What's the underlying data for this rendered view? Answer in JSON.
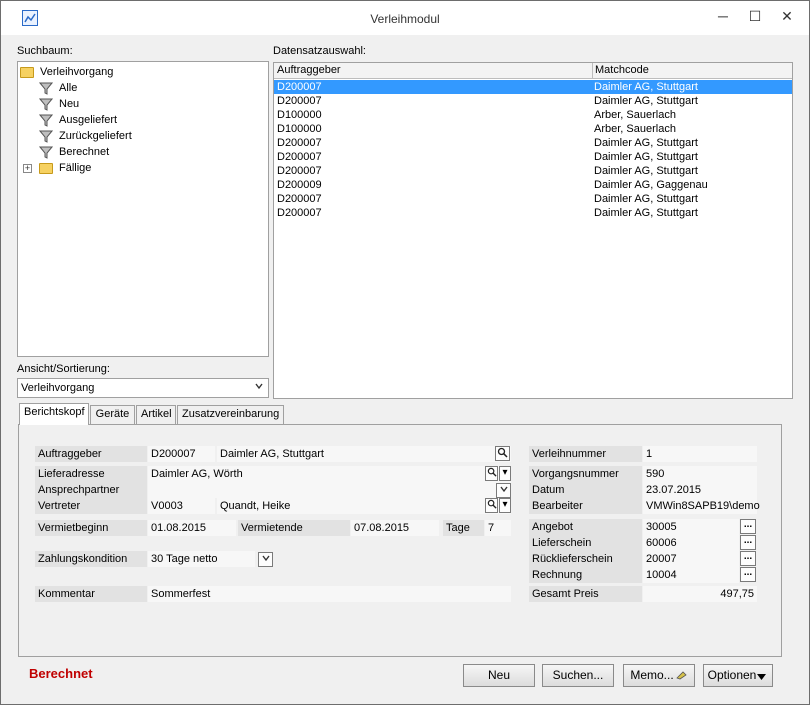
{
  "window": {
    "title": "Verleihmodul",
    "minimize_glyph": "─",
    "maximize_glyph": "☐",
    "close_glyph": "✕"
  },
  "search_tree": {
    "label": "Suchbaum:",
    "items": [
      {
        "label": "Verleihvorgang",
        "icon": "folder-icon"
      },
      {
        "label": "Alle",
        "icon": "filter-icon"
      },
      {
        "label": "Neu",
        "icon": "filter-icon"
      },
      {
        "label": "Ausgeliefert",
        "icon": "filter-icon"
      },
      {
        "label": "Zurückgeliefert",
        "icon": "filter-icon"
      },
      {
        "label": "Berechnet",
        "icon": "filter-icon"
      },
      {
        "label": "Fällige",
        "icon": "folder-icon"
      }
    ],
    "expander_glyph": "+"
  },
  "view_sort": {
    "label": "Ansicht/Sortierung:",
    "selected": "Verleihvorgang"
  },
  "record_selection": {
    "label": "Datensatzauswahl:",
    "columns": [
      "Auftraggeber",
      "Matchcode"
    ],
    "rows": [
      [
        "D200007",
        "Daimler AG, Stuttgart"
      ],
      [
        "D200007",
        "Daimler AG, Stuttgart"
      ],
      [
        "D100000",
        "Arber, Sauerlach"
      ],
      [
        "D100000",
        "Arber, Sauerlach"
      ],
      [
        "D200007",
        "Daimler AG, Stuttgart"
      ],
      [
        "D200007",
        "Daimler AG, Stuttgart"
      ],
      [
        "D200007",
        "Daimler AG, Stuttgart"
      ],
      [
        "D200009",
        "Daimler AG, Gaggenau"
      ],
      [
        "D200007",
        "Daimler AG, Stuttgart"
      ],
      [
        "D200007",
        "Daimler AG, Stuttgart"
      ]
    ],
    "selected_index": 0
  },
  "tabs": [
    "Berichtskopf",
    "Geräte",
    "Artikel",
    "Zusatzvereinbarung"
  ],
  "form": {
    "auftraggeber_label": "Auftraggeber",
    "auftraggeber_code": "D200007",
    "auftraggeber_name": "Daimler AG, Stuttgart",
    "lieferadresse_label": "Lieferadresse",
    "lieferadresse_value": "Daimler AG, Wörth",
    "ansprechpartner_label": "Ansprechpartner",
    "ansprechpartner_value": "",
    "vertreter_label": "Vertreter",
    "vertreter_code": "V0003",
    "vertreter_name": "Quandt, Heike",
    "vermietbeginn_label": "Vermietbeginn",
    "vermietbeginn_value": "01.08.2015",
    "vermietende_label": "Vermietende",
    "vermietende_value": "07.08.2015",
    "tage_label": "Tage",
    "tage_value": "7",
    "zahlungskondition_label": "Zahlungskondition",
    "zahlungskondition_value": "30 Tage netto",
    "kommentar_label": "Kommentar",
    "kommentar_value": "Sommerfest",
    "verleihnummer_label": "Verleihnummer",
    "verleihnummer_value": "1",
    "vorgangsnummer_label": "Vorgangsnummer",
    "vorgangsnummer_value": "590",
    "datum_label": "Datum",
    "datum_value": "23.07.2015",
    "bearbeiter_label": "Bearbeiter",
    "bearbeiter_value": "VMWin8SAPB19\\demo",
    "angebot_label": "Angebot",
    "angebot_value": "30005",
    "lieferschein_label": "Lieferschein",
    "lieferschein_value": "60006",
    "ruecklieferschein_label": "Rücklieferschein",
    "ruecklieferschein_value": "20007",
    "rechnung_label": "Rechnung",
    "rechnung_value": "10004",
    "gesamtpreis_label": "Gesamt Preis",
    "gesamtpreis_value": "497,75",
    "dots_glyph": "...",
    "dropdown_glyph": "▾"
  },
  "status": {
    "text": "Berechnet",
    "color": "#c00000"
  },
  "buttons": {
    "neu": "Neu",
    "suchen": "Suchen...",
    "memo": "Memo...",
    "optionen": "Optionen"
  },
  "colors": {
    "selection": "#3399ff",
    "status": "#c00000"
  }
}
